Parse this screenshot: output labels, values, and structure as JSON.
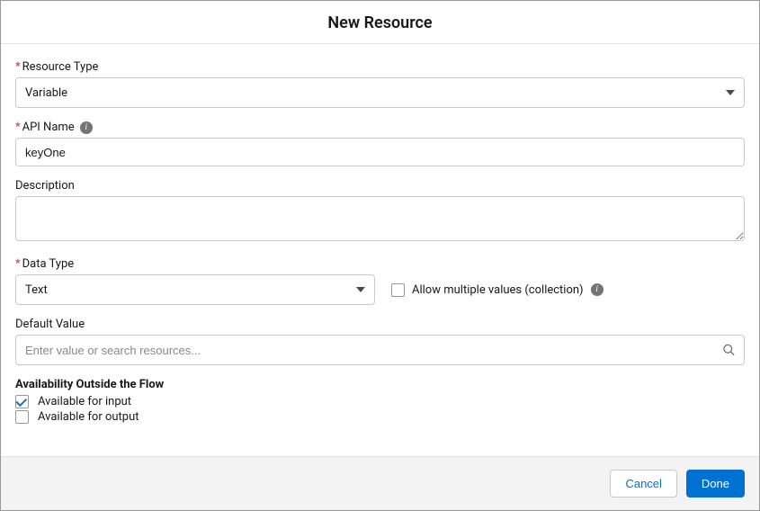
{
  "modal": {
    "title": "New Resource",
    "resourceType": {
      "label": "Resource Type",
      "value": "Variable"
    },
    "apiName": {
      "label": "API Name",
      "value": "keyOne"
    },
    "description": {
      "label": "Description",
      "value": ""
    },
    "dataType": {
      "label": "Data Type",
      "value": "Text"
    },
    "allowMultiple": {
      "label": "Allow multiple values (collection)",
      "checked": false
    },
    "defaultValue": {
      "label": "Default Value",
      "placeholder": "Enter value or search resources...",
      "value": ""
    },
    "availability": {
      "heading": "Availability Outside the Flow",
      "input": {
        "label": "Available for input",
        "checked": true
      },
      "output": {
        "label": "Available for output",
        "checked": false
      }
    },
    "buttons": {
      "cancel": "Cancel",
      "done": "Done"
    }
  }
}
